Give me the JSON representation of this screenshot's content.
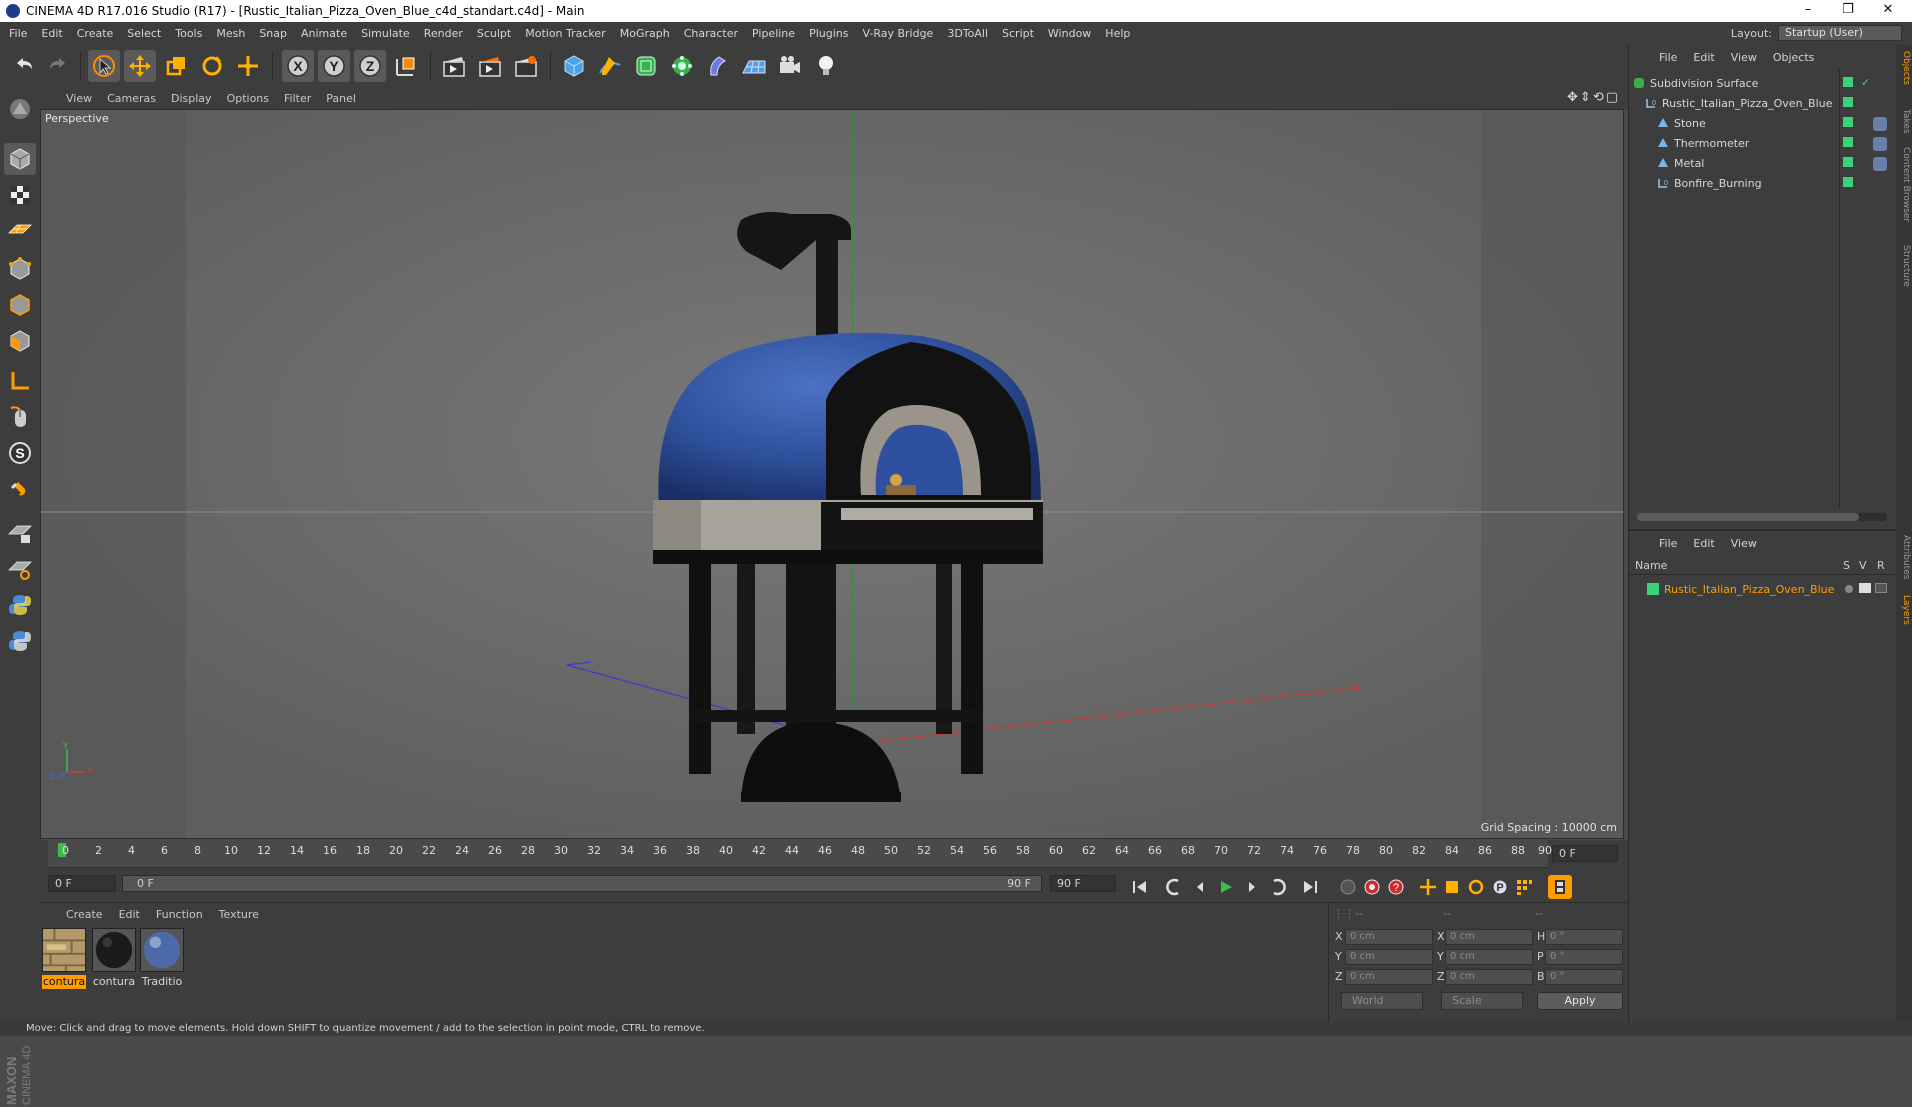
{
  "window": {
    "title": "CINEMA 4D R17.016 Studio (R17) - [Rustic_Italian_Pizza_Oven_Blue_c4d_standart.c4d] - Main",
    "minimize": "–",
    "maximize": "❐",
    "close": "✕"
  },
  "menu": [
    "File",
    "Edit",
    "Create",
    "Select",
    "Tools",
    "Mesh",
    "Snap",
    "Animate",
    "Simulate",
    "Render",
    "Sculpt",
    "Motion Tracker",
    "MoGraph",
    "Character",
    "Pipeline",
    "Plugins",
    "V-Ray Bridge",
    "3DToAll",
    "Script",
    "Window",
    "Help"
  ],
  "layout": {
    "label": "Layout:",
    "value": "Startup (User)"
  },
  "viewport": {
    "menu": [
      "View",
      "Cameras",
      "Display",
      "Options",
      "Filter",
      "Panel"
    ],
    "label": "Perspective",
    "grid_spacing": "Grid Spacing : 10000 cm",
    "nav_icons": "✥⇕⟲▢"
  },
  "axis_labels": {
    "x": "X",
    "y": "Y",
    "z": "Z"
  },
  "toolbar": {
    "axis_x": "X",
    "axis_y": "Y",
    "axis_z": "Z"
  },
  "timeline": {
    "ticks": [
      "0",
      "2",
      "4",
      "6",
      "8",
      "10",
      "12",
      "14",
      "16",
      "18",
      "20",
      "22",
      "24",
      "26",
      "28",
      "30",
      "32",
      "34",
      "36",
      "38",
      "40",
      "42",
      "44",
      "46",
      "48",
      "50",
      "52",
      "54",
      "56",
      "58",
      "60",
      "62",
      "64",
      "66",
      "68",
      "70",
      "72",
      "74",
      "76",
      "78",
      "80",
      "82",
      "84",
      "86",
      "88",
      "90"
    ],
    "current_frame": "0 F",
    "start_frame": "0 F",
    "range_start": "0 F",
    "range_end": "90 F",
    "end_frame": "90 F"
  },
  "materials": {
    "menu": [
      "Create",
      "Edit",
      "Function",
      "Texture"
    ],
    "items": [
      {
        "name": "contura",
        "selected": true
      },
      {
        "name": "contura",
        "selected": false
      },
      {
        "name": "Traditio",
        "selected": false
      }
    ]
  },
  "coords": {
    "headers": [
      "--",
      "--",
      "--"
    ],
    "rows": [
      {
        "l1": "X",
        "v1": "0 cm",
        "l2": "X",
        "v2": "0 cm",
        "l3": "H",
        "v3": "0 °"
      },
      {
        "l1": "Y",
        "v1": "0 cm",
        "l2": "Y",
        "v2": "0 cm",
        "l3": "P",
        "v3": "0 °"
      },
      {
        "l1": "Z",
        "v1": "0 cm",
        "l2": "Z",
        "v2": "0 cm",
        "l3": "B",
        "v3": "0 °"
      }
    ],
    "mode": "World",
    "transform": "Scale",
    "apply": "Apply"
  },
  "objects": {
    "menu": [
      "File",
      "Edit",
      "View",
      "Objects"
    ],
    "items": [
      {
        "name": "Subdivision Surface",
        "indent": 0,
        "color": "#3ad27a"
      },
      {
        "name": "Rustic_Italian_Pizza_Oven_Blue",
        "indent": 1,
        "color": "#3ad27a"
      },
      {
        "name": "Stone",
        "indent": 2,
        "color": "#3ad27a"
      },
      {
        "name": "Thermometer",
        "indent": 2,
        "color": "#3ad27a"
      },
      {
        "name": "Metal",
        "indent": 2,
        "color": "#3ad27a"
      },
      {
        "name": "Bonfire_Burning",
        "indent": 2,
        "color": "#3ad27a"
      }
    ]
  },
  "layers": {
    "menu": [
      "File",
      "Edit",
      "View"
    ],
    "header_name": "Name",
    "header_s": "S",
    "header_v": "V",
    "header_r": "R",
    "items": [
      {
        "name": "Rustic_Italian_Pizza_Oven_Blue",
        "color": "#3ad27a"
      }
    ]
  },
  "right_tabs": [
    "Objects",
    "Takes",
    "Content Browser",
    "Structure",
    "Attributes",
    "Layers"
  ],
  "brand": "MAXON CINEMA 4D",
  "status": "Move: Click and drag to move elements. Hold down SHIFT to quantize movement / add to the selection in point mode, CTRL to remove.",
  "colors": {
    "accent": "#ff9d00",
    "layer_green": "#3ad27a",
    "playhead": "#3ac04a"
  }
}
